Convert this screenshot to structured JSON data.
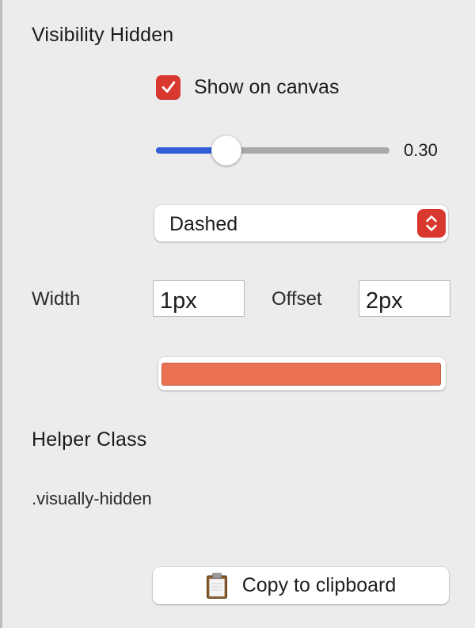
{
  "visibility": {
    "title": "Visibility Hidden",
    "show_on_canvas": {
      "label": "Show on canvas",
      "checked": true
    },
    "opacity": {
      "value": 0.3,
      "display": "0.30"
    },
    "style_select": {
      "selected": "Dashed"
    },
    "width": {
      "label": "Width",
      "value": "1px"
    },
    "offset": {
      "label": "Offset",
      "value": "2px"
    },
    "color": "#ec7052"
  },
  "helper": {
    "title": "Helper Class",
    "class_name": ".visually-hidden",
    "copy_label": "Copy to clipboard",
    "copy_icon": "clipboard-icon"
  },
  "colors": {
    "accent": "#d9382f",
    "slider_fill": "#2f5ed6"
  }
}
